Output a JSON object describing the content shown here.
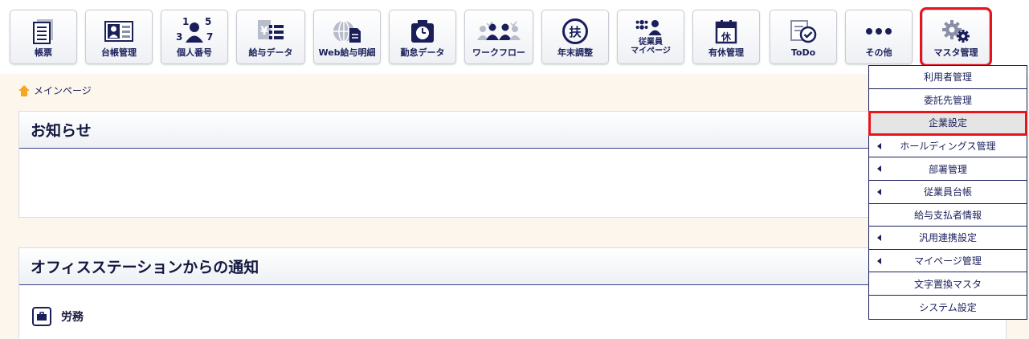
{
  "toolbar": {
    "items": [
      {
        "label": "帳票",
        "icon": "ledger-icon"
      },
      {
        "label": "台帳管理",
        "icon": "id-card-icon"
      },
      {
        "label": "個人番号",
        "icon": "personal-number-icon"
      },
      {
        "label": "給与データ",
        "icon": "payroll-data-icon"
      },
      {
        "label": "Web給与明細",
        "icon": "web-payslip-icon"
      },
      {
        "label": "勤怠データ",
        "icon": "attendance-clock-icon"
      },
      {
        "label": "ワークフロー",
        "icon": "workflow-people-icon"
      },
      {
        "label": "年末調整",
        "icon": "year-end-adjustment-icon"
      },
      {
        "label": "従業員\nマイページ",
        "icon": "employee-mypage-icon",
        "badge": "従業員"
      },
      {
        "label": "有休管理",
        "icon": "paid-leave-calendar-icon",
        "badge": "休"
      },
      {
        "label": "ToDo",
        "icon": "todo-check-icon"
      },
      {
        "label": "その他",
        "icon": "more-dots-icon"
      },
      {
        "label": "マスタ管理",
        "icon": "gear-icon"
      }
    ],
    "year_end_glyph": "扶",
    "personal_number_glyph": {
      "a": "1",
      "b": "5",
      "c": "3",
      "d": "7"
    }
  },
  "breadcrumb": {
    "label": "メインページ"
  },
  "notices": {
    "title": "お知らせ"
  },
  "office_notices": {
    "title": "オフィスステーションからの通知",
    "section_label": "労務"
  },
  "master_menu": {
    "items": [
      {
        "label": "利用者管理",
        "submenu": false
      },
      {
        "label": "委託先管理",
        "submenu": false
      },
      {
        "label": "企業設定",
        "submenu": false,
        "highlighted": true
      },
      {
        "label": "ホールディングス管理",
        "submenu": true
      },
      {
        "label": "部署管理",
        "submenu": true
      },
      {
        "label": "従業員台帳",
        "submenu": true
      },
      {
        "label": "給与支払者情報",
        "submenu": false
      },
      {
        "label": "汎用連携設定",
        "submenu": true
      },
      {
        "label": "マイページ管理",
        "submenu": true
      },
      {
        "label": "文字置換マスタ",
        "submenu": false
      },
      {
        "label": "システム設定",
        "submenu": false
      }
    ]
  },
  "colors": {
    "accent_navy": "#1a1f5a",
    "highlight_red": "#e8141b",
    "content_bg": "#fdf6ec"
  }
}
